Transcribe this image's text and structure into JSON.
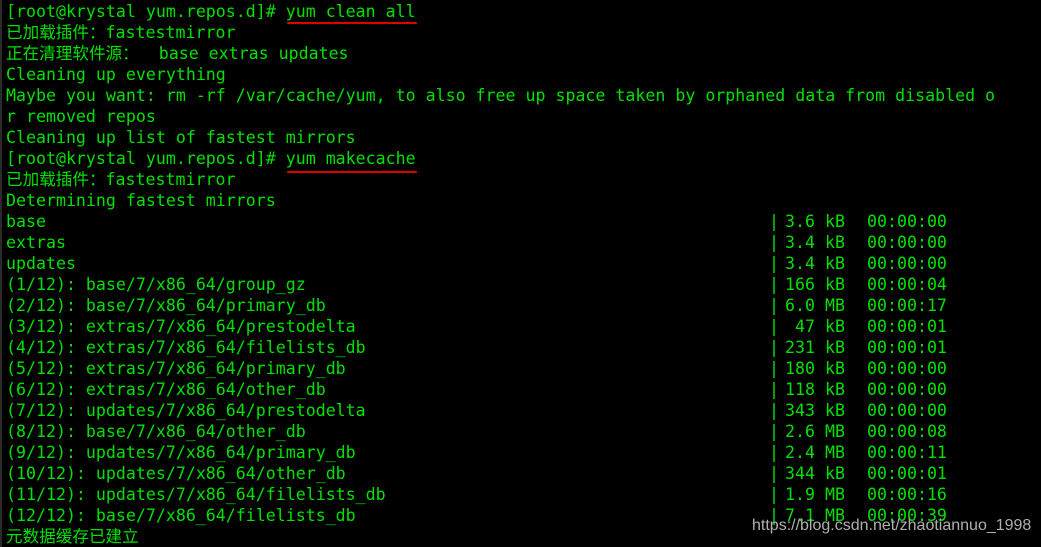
{
  "terminal": {
    "colors": {
      "text": "#00e000",
      "background": "#000000",
      "underline": "#e00000"
    },
    "prompt": "[root@krystal yum.repos.d]# ",
    "commands": [
      "yum clean all",
      "yum makecache"
    ],
    "lines_clean": [
      "已加载插件：fastestmirror",
      "正在清理软件源：  base extras updates",
      "Cleaning up everything",
      "Maybe you want: rm -rf /var/cache/yum, to also free up space taken by orphaned data from disabled o",
      "r removed repos",
      "Cleaning up list of fastest mirrors"
    ],
    "lines_make": [
      "已加载插件：fastestmirror",
      "Determining fastest mirrors"
    ],
    "rows": [
      {
        "name": "base",
        "size": "3.6 kB",
        "time": "00:00:00"
      },
      {
        "name": "extras",
        "size": "3.4 kB",
        "time": "00:00:00"
      },
      {
        "name": "updates",
        "size": "3.4 kB",
        "time": "00:00:00"
      },
      {
        "name": "(1/12): base/7/x86_64/group_gz",
        "size": "166 kB",
        "time": "00:00:04"
      },
      {
        "name": "(2/12): base/7/x86_64/primary_db",
        "size": "6.0 MB",
        "time": "00:00:17"
      },
      {
        "name": "(3/12): extras/7/x86_64/prestodelta",
        "size": " 47 kB",
        "time": "00:00:01"
      },
      {
        "name": "(4/12): extras/7/x86_64/filelists_db",
        "size": "231 kB",
        "time": "00:00:01"
      },
      {
        "name": "(5/12): extras/7/x86_64/primary_db",
        "size": "180 kB",
        "time": "00:00:00"
      },
      {
        "name": "(6/12): extras/7/x86_64/other_db",
        "size": "118 kB",
        "time": "00:00:00"
      },
      {
        "name": "(7/12): updates/7/x86_64/prestodelta",
        "size": "343 kB",
        "time": "00:00:00"
      },
      {
        "name": "(8/12): base/7/x86_64/other_db",
        "size": "2.6 MB",
        "time": "00:00:08"
      },
      {
        "name": "(9/12): updates/7/x86_64/primary_db",
        "size": "2.4 MB",
        "time": "00:00:11"
      },
      {
        "name": "(10/12): updates/7/x86_64/other_db",
        "size": "344 kB",
        "time": "00:00:01"
      },
      {
        "name": "(11/12): updates/7/x86_64/filelists_db",
        "size": "1.9 MB",
        "time": "00:00:16"
      },
      {
        "name": "(12/12): base/7/x86_64/filelists_db",
        "size": "7.1 MB",
        "time": "00:00:39"
      }
    ],
    "final_line": "元数据缓存已建立",
    "separator": "|"
  },
  "watermark": "https://blog.csdn.net/zhaotiannuo_1998"
}
